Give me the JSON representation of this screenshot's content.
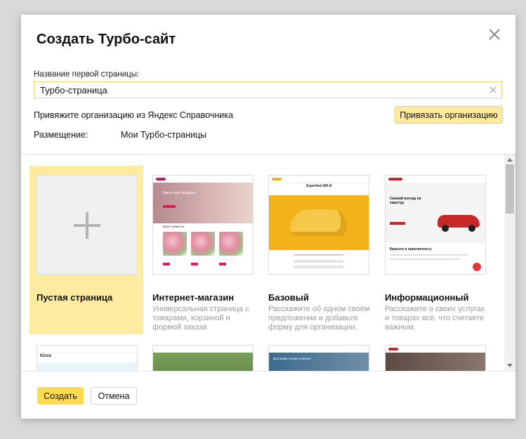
{
  "dialog": {
    "title": "Создать Турбо-сайт",
    "page_name_label": "Название первой страницы:",
    "page_name_value": "Турбо-страница",
    "org_text": "Привяжите организацию из Яндекс Справочника",
    "org_button": "Привязать организацию",
    "placement_label": "Размещение:",
    "placement_value": "Мои Турбо-страницы"
  },
  "templates": [
    {
      "title": "Пустая страница",
      "description": "",
      "selected": true
    },
    {
      "title": "Интернет-магазин",
      "description": "Универсальная страница с товарами, корзиной и формой заказа",
      "selected": false
    },
    {
      "title": "Базовый",
      "description": "Расскажите об одном своём предложении и добавьте форму для организации.",
      "selected": false
    },
    {
      "title": "Информационный",
      "description": "Расскажите о своих услугах и товарах всё, что считаете важным.",
      "selected": false
    }
  ],
  "thumbnails": {
    "flowers_heading": "Цветы для свадьбы",
    "flowers_sub": "Букет невесты",
    "shoe_heading": "Superfeet MX-8",
    "car_heading": "Свежий взгляд на евротур",
    "car_sub": "Красота и практичность",
    "row2_1": "Kinzo",
    "row2_3": "Доставим только полезно"
  },
  "footer": {
    "create": "Создать",
    "cancel": "Отмена"
  },
  "colors": {
    "accent": "#ffdb4d",
    "selected_card": "#fdeba0",
    "input_border": "#f0d76b"
  }
}
